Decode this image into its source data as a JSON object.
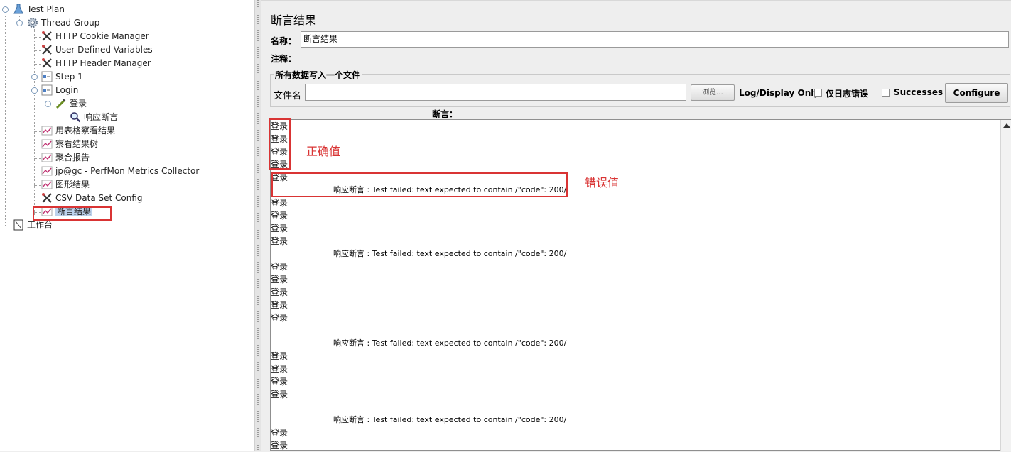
{
  "tree": {
    "items": [
      {
        "label": "Test Plan",
        "icon": "test-plan-icon",
        "level": 0
      },
      {
        "label": "Thread Group",
        "icon": "gear-icon",
        "level": 1
      },
      {
        "label": "HTTP Cookie Manager",
        "icon": "wrench-scissors-icon",
        "level": 2
      },
      {
        "label": "User Defined Variables",
        "icon": "wrench-scissors-icon",
        "level": 2
      },
      {
        "label": "HTTP Header Manager",
        "icon": "wrench-scissors-icon",
        "level": 2
      },
      {
        "label": "Step 1",
        "icon": "controller-icon",
        "level": 2
      },
      {
        "label": "Login",
        "icon": "controller-icon",
        "level": 2
      },
      {
        "label": "登录",
        "icon": "sampler-icon",
        "level": 3
      },
      {
        "label": "响应断言",
        "icon": "magnifier-icon",
        "level": 4
      },
      {
        "label": "用表格察看结果",
        "icon": "listener-icon",
        "level": 2
      },
      {
        "label": "察看结果树",
        "icon": "listener-icon",
        "level": 2
      },
      {
        "label": "聚合报告",
        "icon": "listener-icon",
        "level": 2
      },
      {
        "label": "jp@gc - PerfMon Metrics Collector",
        "icon": "listener-icon",
        "level": 2
      },
      {
        "label": "图形结果",
        "icon": "listener-icon",
        "level": 2
      },
      {
        "label": "CSV Data Set Config",
        "icon": "wrench-scissors-icon",
        "level": 2
      },
      {
        "label": "断言结果",
        "icon": "listener-icon",
        "level": 2,
        "selected": true
      },
      {
        "label": "工作台",
        "icon": "workbench-icon",
        "level": 0
      }
    ]
  },
  "panel": {
    "title": "断言结果",
    "name_label": "名称：",
    "name_value": "断言结果",
    "comment_label": "注释：",
    "comment_value": "",
    "file_group_title": "所有数据写入一个文件",
    "filename_label": "文件名",
    "filename_value": "",
    "browse_label": "浏览...",
    "log_display_label": "Log/Display Only:",
    "errors_only_label": "仅日志错误",
    "successes_label": "Successes",
    "configure_label": "Configure",
    "assertions_header": "断言："
  },
  "results": [
    {
      "type": "sample",
      "text": "登录"
    },
    {
      "type": "sample",
      "text": "登录"
    },
    {
      "type": "sample",
      "text": "登录"
    },
    {
      "type": "sample",
      "text": "登录"
    },
    {
      "type": "sample",
      "text": "登录"
    },
    {
      "type": "fail",
      "text": "响应断言 : Test failed: text expected to contain /\"code\": 200/"
    },
    {
      "type": "sample",
      "text": "登录"
    },
    {
      "type": "sample",
      "text": "登录"
    },
    {
      "type": "sample",
      "text": "登录"
    },
    {
      "type": "sample",
      "text": "登录"
    },
    {
      "type": "fail",
      "text": "响应断言 : Test failed: text expected to contain /\"code\": 200/"
    },
    {
      "type": "sample",
      "text": "登录"
    },
    {
      "type": "sample",
      "text": "登录"
    },
    {
      "type": "sample",
      "text": "登录"
    },
    {
      "type": "sample",
      "text": "登录"
    },
    {
      "type": "sample",
      "text": "登录"
    },
    {
      "type": "blank",
      "text": ""
    },
    {
      "type": "fail",
      "text": "响应断言 : Test failed: text expected to contain /\"code\": 200/"
    },
    {
      "type": "sample",
      "text": "登录"
    },
    {
      "type": "sample",
      "text": "登录"
    },
    {
      "type": "sample",
      "text": "登录"
    },
    {
      "type": "sample",
      "text": "登录"
    },
    {
      "type": "blank",
      "text": ""
    },
    {
      "type": "fail",
      "text": "响应断言 : Test failed: text expected to contain /\"code\": 200/"
    },
    {
      "type": "sample",
      "text": "登录"
    },
    {
      "type": "sample",
      "text": "登录"
    }
  ],
  "annotations": {
    "correct_label": "正确值",
    "error_label": "错误值",
    "color": "#d93434"
  }
}
